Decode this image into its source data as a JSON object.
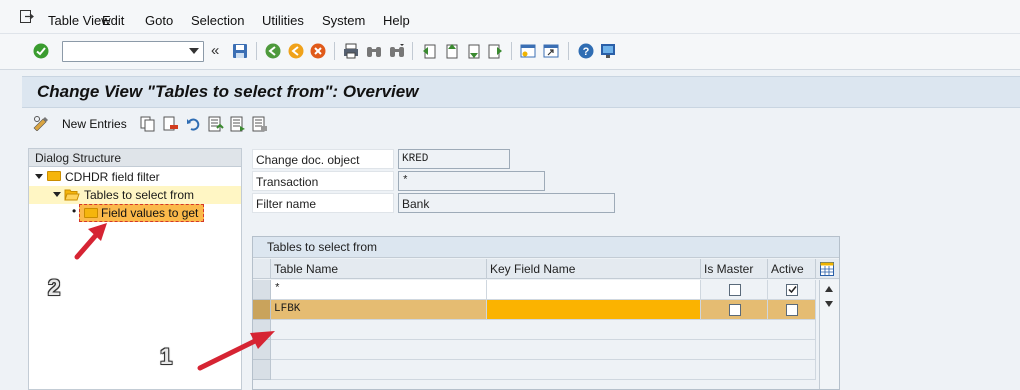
{
  "menu": {
    "items": [
      "Table View",
      "Edit",
      "Goto",
      "Selection",
      "Utilities",
      "System",
      "Help"
    ],
    "underlines": [
      "T",
      "E",
      "G",
      "S",
      "U",
      "y",
      "H"
    ]
  },
  "toolbar": {
    "command_value": "",
    "collapse_glyph": "«"
  },
  "title": "Change View \"Tables to select from\": Overview",
  "app_toolbar": {
    "new_entries_label": "New Entries"
  },
  "nav": {
    "header": "Dialog Structure",
    "items": [
      {
        "label": "CDHDR field filter",
        "level": 0
      },
      {
        "label": "Tables to select from",
        "level": 1
      },
      {
        "label": "Field values to get",
        "level": 2
      }
    ]
  },
  "form": {
    "change_doc_object": {
      "label": "Change doc. object",
      "value": "KRED"
    },
    "transaction": {
      "label": "Transaction",
      "value": "*"
    },
    "filter_name": {
      "label": "Filter name",
      "value": "Bank"
    }
  },
  "table": {
    "title": "Tables to select from",
    "columns": [
      "Table Name",
      "Key Field Name",
      "Is Master",
      "Active"
    ],
    "rows": [
      {
        "table_name": "*",
        "key_field": "",
        "is_master": false,
        "active": true
      },
      {
        "table_name": "LFBK",
        "key_field": "",
        "is_master": false,
        "active": false
      }
    ]
  },
  "annotations": {
    "marker_1": "1",
    "marker_2": "2"
  },
  "colors": {
    "selected_row": "#e5bc72",
    "highlight_cell": "#fbb300",
    "title_bg": "#dce6f0",
    "annotation_arrow": "#d62433"
  }
}
